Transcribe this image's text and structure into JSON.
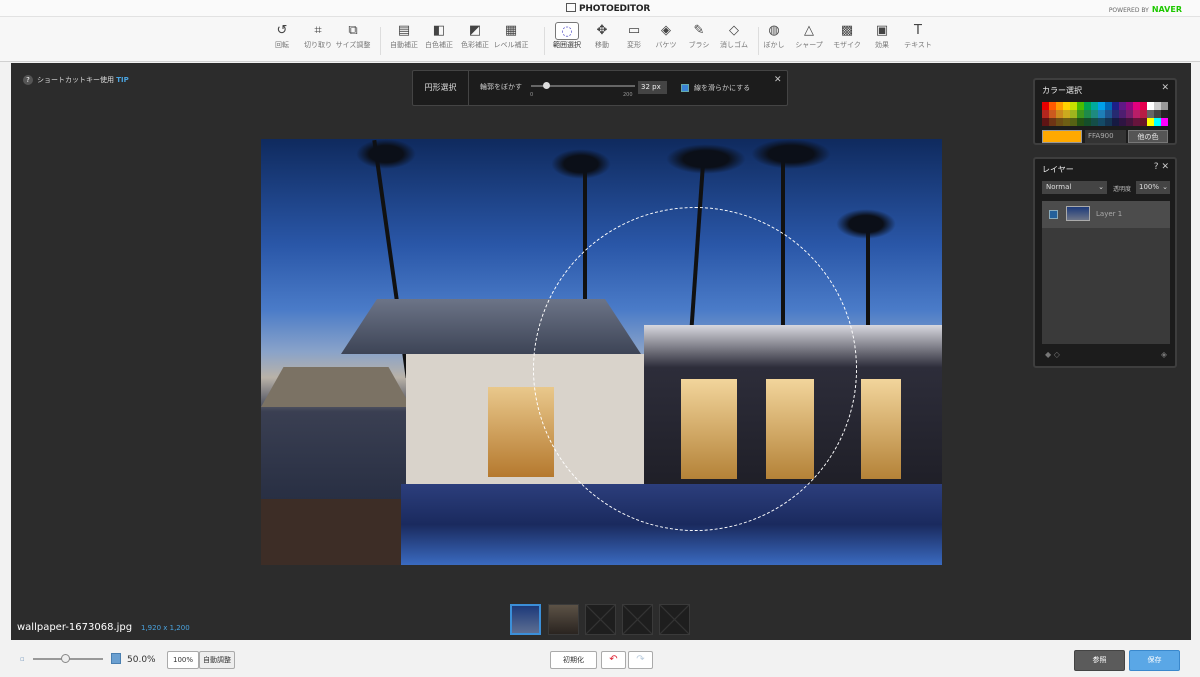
{
  "brand": {
    "name": "PHOTOEDITOR",
    "powered_by": "POWERED BY",
    "naver": "NAVER"
  },
  "tools": [
    {
      "label": "回転",
      "icon": "rotate-icon",
      "glyph": "↺"
    },
    {
      "label": "切り取り",
      "icon": "crop-icon",
      "glyph": "⌗"
    },
    {
      "label": "サイズ調整",
      "icon": "resize-icon",
      "glyph": "⧉"
    },
    {
      "label": "自動補正",
      "icon": "auto-correct-icon",
      "glyph": "▤"
    },
    {
      "label": "白色補正",
      "icon": "white-balance-icon",
      "glyph": "◧"
    },
    {
      "label": "色彩補正",
      "icon": "color-correct-icon",
      "glyph": "◩"
    },
    {
      "label": "レベル補正",
      "icon": "levels-icon",
      "glyph": "▦"
    },
    {
      "label": "範囲選択",
      "icon": "selection-icon",
      "glyph": "◌"
    },
    {
      "label": "移動",
      "icon": "move-icon",
      "glyph": "✥"
    },
    {
      "label": "変形",
      "icon": "transform-icon",
      "glyph": "▭"
    },
    {
      "label": "バケツ",
      "icon": "bucket-icon",
      "glyph": "◈"
    },
    {
      "label": "ブラシ",
      "icon": "brush-icon",
      "glyph": "✎"
    },
    {
      "label": "消しゴム",
      "icon": "eraser-icon",
      "glyph": "◇"
    },
    {
      "label": "ぼかし",
      "icon": "blur-icon",
      "glyph": "◍"
    },
    {
      "label": "シャープ",
      "icon": "sharpen-icon",
      "glyph": "△"
    },
    {
      "label": "モザイク",
      "icon": "mosaic-icon",
      "glyph": "▩"
    },
    {
      "label": "効果",
      "icon": "effect-icon",
      "glyph": "▣"
    },
    {
      "label": "テキスト",
      "icon": "text-icon",
      "glyph": "T"
    }
  ],
  "active_tool": "範囲選択",
  "shortcut_tip": {
    "text": "ショートカットキー使用",
    "tip": "TIP"
  },
  "options": {
    "title": "円形選択",
    "feather_label": "輪郭をぼかす",
    "slider_min": "0",
    "slider_max": "200",
    "feather_value": "32 px",
    "smooth_label": "線を滑らかにする",
    "smooth_checked": true
  },
  "file": {
    "name": "wallpaper-1673068.jpg",
    "dimensions": "1,920 x 1,200"
  },
  "color_panel": {
    "title": "カラー選択",
    "current_color": "#FFA900",
    "hex_value": "FFA900",
    "other_label": "他の色",
    "swatches": [
      "#e40000",
      "#ff5a00",
      "#ff9c00",
      "#ffd200",
      "#c6e200",
      "#4bbd00",
      "#00a651",
      "#00a99d",
      "#00a0e9",
      "#0068b7",
      "#1d2088",
      "#601986",
      "#920783",
      "#e4007f",
      "#e5004f",
      "#ffffff",
      "#cccccc",
      "#999999",
      "#b3261e",
      "#cc5a1e",
      "#cc8a1e",
      "#ccaa1e",
      "#9fb51e",
      "#3d961e",
      "#1e8a4a",
      "#1e8a80",
      "#1e7fb8",
      "#1e5590",
      "#262a70",
      "#4e1e70",
      "#761e6c",
      "#b81e68",
      "#b81e44",
      "#666666",
      "#444444",
      "#222222",
      "#5e1414",
      "#6e3414",
      "#6e4e14",
      "#6e5e14",
      "#566214",
      "#245214",
      "#144e2a",
      "#144e48",
      "#144a66",
      "#143452",
      "#161a42",
      "#2e1442",
      "#44143e",
      "#66143c",
      "#661428",
      "#ffff00",
      "#00ffff",
      "#ff00ff"
    ]
  },
  "layer_panel": {
    "title": "レイヤー",
    "help": "?",
    "blend_mode": "Normal",
    "opacity_label": "透明度",
    "opacity_value": "100%",
    "layers": [
      {
        "name": "Layer 1",
        "visible": true
      }
    ]
  },
  "bottom": {
    "zoom": "50.0%",
    "btn_100": "100%",
    "btn_auto": "自動調整",
    "btn_init": "初期化",
    "btn_ref": "参照",
    "btn_save": "保存"
  },
  "thumbnails": [
    {
      "state": "selected"
    },
    {
      "state": "image"
    },
    {
      "state": "empty"
    },
    {
      "state": "empty"
    },
    {
      "state": "empty"
    }
  ]
}
